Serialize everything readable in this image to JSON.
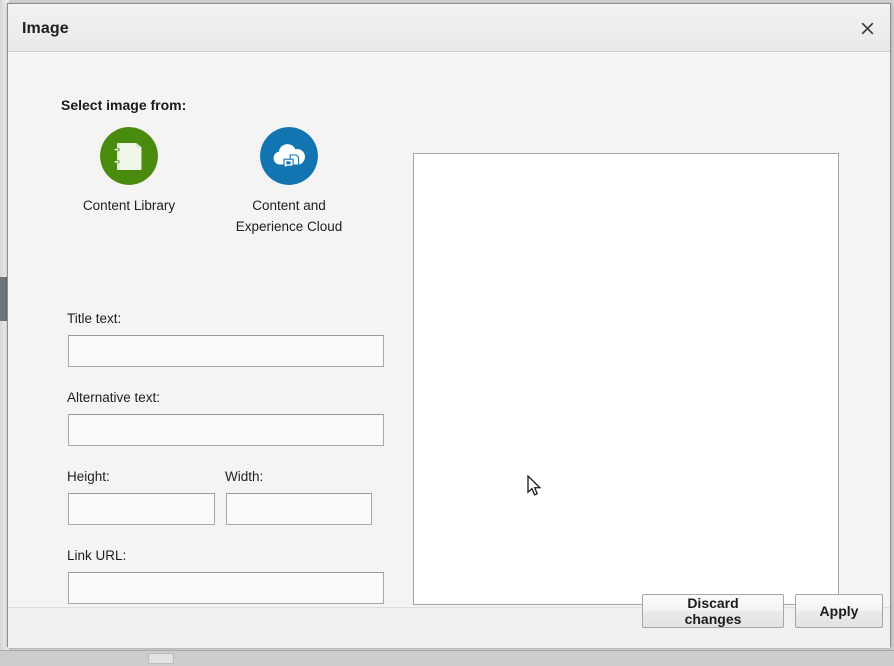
{
  "window": {
    "title": "Image",
    "close_label": "✕",
    "close_icon": "close-icon"
  },
  "left_panel": {
    "section_heading": "Select image from:",
    "sources": [
      {
        "id": "content-library",
        "label": "Content Library",
        "icon": "book-icon",
        "color": "#4a8a0f"
      },
      {
        "id": "content-and-experience-cloud",
        "label_line1": "Content and",
        "label_line2": "Experience Cloud",
        "icon": "cloud-document-icon",
        "color": "#1275b1"
      }
    ],
    "fields": {
      "title_text": {
        "label": "Title text:",
        "value": "",
        "placeholder": ""
      },
      "alternative_text": {
        "label": "Alternative text:",
        "value": "",
        "placeholder": ""
      },
      "height": {
        "label": "Height:",
        "value": "",
        "placeholder": ""
      },
      "width": {
        "label": "Width:",
        "value": "",
        "placeholder": ""
      },
      "link_url": {
        "label": "Link URL:",
        "value": "",
        "placeholder": ""
      }
    }
  },
  "preview": {
    "name": "image-preview-area",
    "content": ""
  },
  "footer": {
    "discard_label": "Discard changes",
    "apply_label": "Apply"
  },
  "colors": {
    "dialog_bg": "#f4f4f4",
    "titlebar_bg": "#eeeeee",
    "input_border": "#a8a8a8",
    "preview_border": "#9fa7ac",
    "content_library_green": "#4a8a0f",
    "cec_blue": "#1275b1"
  }
}
